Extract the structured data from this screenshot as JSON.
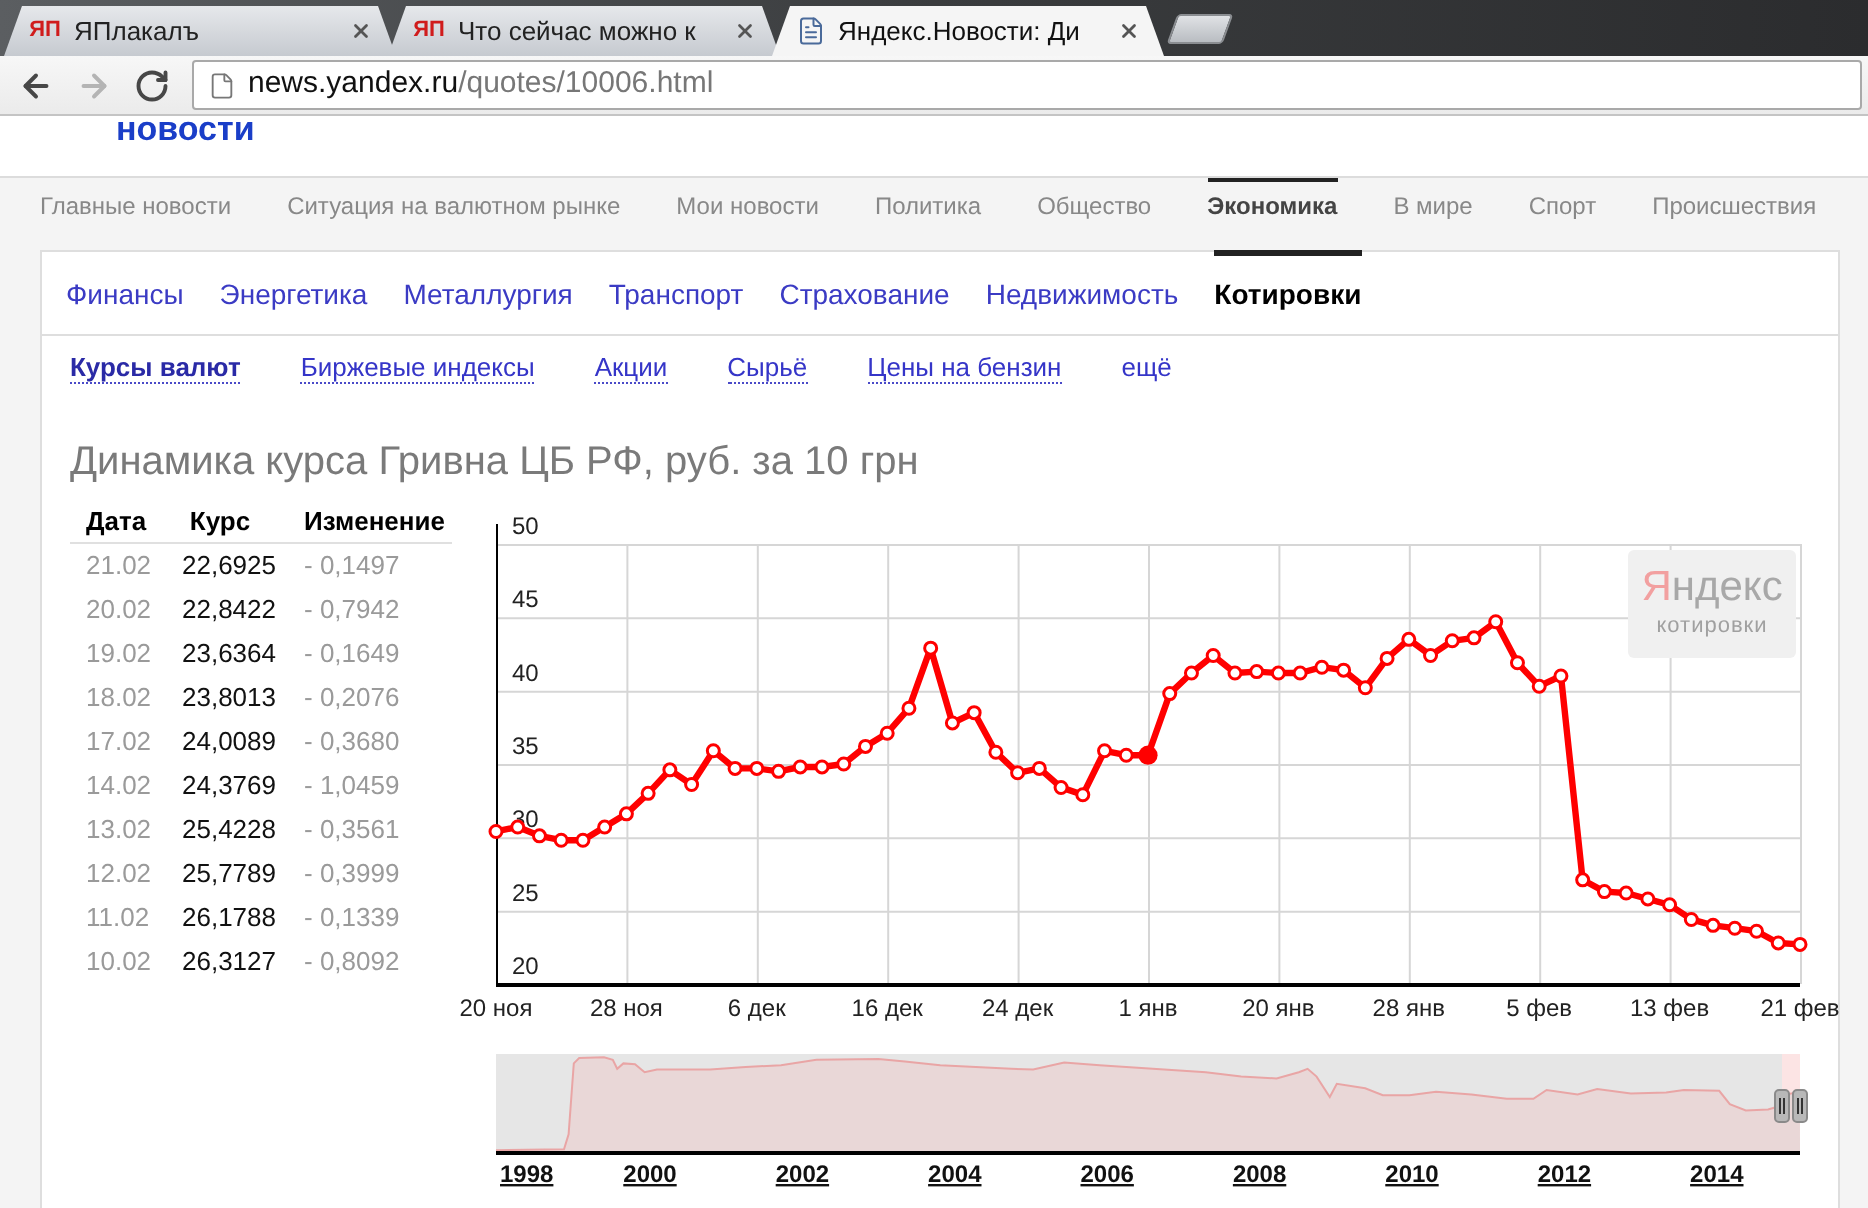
{
  "browser": {
    "tabs": [
      {
        "title": "ЯПлакалъ",
        "selected": false,
        "favicon": {
          "kind": "letters",
          "text": "ЯП"
        }
      },
      {
        "title": "Что сейчас можно к",
        "selected": false,
        "favicon": {
          "kind": "letters",
          "text": "ЯП"
        }
      },
      {
        "title": "Яндекс.Новости: Ди",
        "selected": true,
        "favicon": {
          "kind": "page"
        }
      }
    ],
    "nav_buttons": [
      {
        "kind": "back",
        "disabled": false
      },
      {
        "kind": "forward",
        "disabled": true
      },
      {
        "kind": "reload",
        "disabled": false
      }
    ],
    "address": {
      "host": "news.yandex.ru",
      "path": "/quotes/10006.html"
    }
  },
  "header": {
    "logo_text": "новости"
  },
  "main_nav": [
    {
      "label": "Главные новости",
      "selected": false
    },
    {
      "label": "Ситуация на валютном рынке",
      "selected": false
    },
    {
      "label": "Мои новости",
      "selected": false
    },
    {
      "label": "Политика",
      "selected": false
    },
    {
      "label": "Общество",
      "selected": false
    },
    {
      "label": "Экономика",
      "selected": true
    },
    {
      "label": "В мире",
      "selected": false
    },
    {
      "label": "Спорт",
      "selected": false
    },
    {
      "label": "Происшествия",
      "selected": false
    }
  ],
  "sub_nav": [
    {
      "label": "Финансы",
      "selected": false
    },
    {
      "label": "Энергетика",
      "selected": false
    },
    {
      "label": "Металлургия",
      "selected": false
    },
    {
      "label": "Транспорт",
      "selected": false
    },
    {
      "label": "Страхование",
      "selected": false
    },
    {
      "label": "Недвижимость",
      "selected": false
    },
    {
      "label": "Котировки",
      "selected": true
    }
  ],
  "sections": [
    {
      "label": "Курсы валют",
      "selected": true,
      "kind": "link"
    },
    {
      "label": "Биржевые индексы",
      "selected": false,
      "kind": "link"
    },
    {
      "label": "Акции",
      "selected": false,
      "kind": "link"
    },
    {
      "label": "Сырьё",
      "selected": false,
      "kind": "link"
    },
    {
      "label": "Цены на бензин",
      "selected": false,
      "kind": "link"
    },
    {
      "label": "ещё",
      "selected": false,
      "kind": "more"
    }
  ],
  "title": "Динамика курса Гривна ЦБ РФ, руб. за 10 грн",
  "table": {
    "columns": [
      "Дата",
      "Курс",
      "Изменение"
    ],
    "rows": [
      [
        "21.02",
        "22,6925",
        "- 0,1497"
      ],
      [
        "20.02",
        "22,8422",
        "- 0,7942"
      ],
      [
        "19.02",
        "23,6364",
        "- 0,1649"
      ],
      [
        "18.02",
        "23,8013",
        "- 0,2076"
      ],
      [
        "17.02",
        "24,0089",
        "- 0,3680"
      ],
      [
        "14.02",
        "24,3769",
        "- 1,0459"
      ],
      [
        "13.02",
        "25,4228",
        "- 0,3561"
      ],
      [
        "12.02",
        "25,7789",
        "- 0,3999"
      ],
      [
        "11.02",
        "26,1788",
        "- 0,1339"
      ],
      [
        "10.02",
        "26,3127",
        "- 0,8092"
      ]
    ]
  },
  "chart": {
    "chart_data": {
      "type": "line",
      "categories": [
        "20 ноя",
        null,
        null,
        null,
        null,
        null,
        "28 ноя",
        null,
        null,
        null,
        null,
        null,
        "6 дек",
        null,
        null,
        null,
        null,
        null,
        "16 дек",
        null,
        null,
        null,
        null,
        null,
        "24 дек",
        null,
        null,
        null,
        null,
        null,
        "1 янв",
        null,
        null,
        null,
        null,
        null,
        "20 янв",
        null,
        null,
        null,
        null,
        null,
        "28 янв",
        null,
        null,
        null,
        null,
        null,
        "5 фев",
        null,
        null,
        null,
        null,
        null,
        "13 фев",
        null,
        null,
        null,
        null,
        null,
        "21 фев"
      ],
      "values": [
        30.4,
        30.7,
        30.1,
        29.8,
        29.8,
        30.7,
        31.6,
        33.0,
        34.6,
        33.6,
        35.9,
        34.7,
        34.7,
        34.5,
        34.8,
        34.8,
        35.0,
        36.2,
        37.1,
        38.8,
        42.9,
        37.8,
        38.5,
        35.8,
        34.4,
        34.7,
        33.4,
        32.9,
        35.9,
        35.6,
        35.6,
        39.8,
        41.2,
        42.4,
        41.2,
        41.3,
        41.2,
        41.2,
        41.6,
        41.4,
        40.2,
        42.2,
        43.5,
        42.4,
        43.4,
        43.6,
        44.7,
        41.9,
        40.3,
        41.0,
        27.1,
        26.3,
        26.2,
        25.8,
        25.4,
        24.4,
        24.0,
        23.8,
        23.6,
        22.8,
        22.7
      ],
      "ylim": [
        20,
        50
      ],
      "yticks": [
        20,
        25,
        30,
        35,
        40,
        45,
        50
      ],
      "grid": true,
      "marker": "circle",
      "annotations": [
        {
          "x": "1 янв"
        }
      ]
    },
    "logo": {
      "brand": "Яндекс",
      "caption": "котировки"
    }
  },
  "navigator": {
    "years": [
      "1998",
      "2000",
      "2002",
      "2004",
      "2006",
      "2008",
      "2010",
      "2012",
      "2014"
    ]
  }
}
